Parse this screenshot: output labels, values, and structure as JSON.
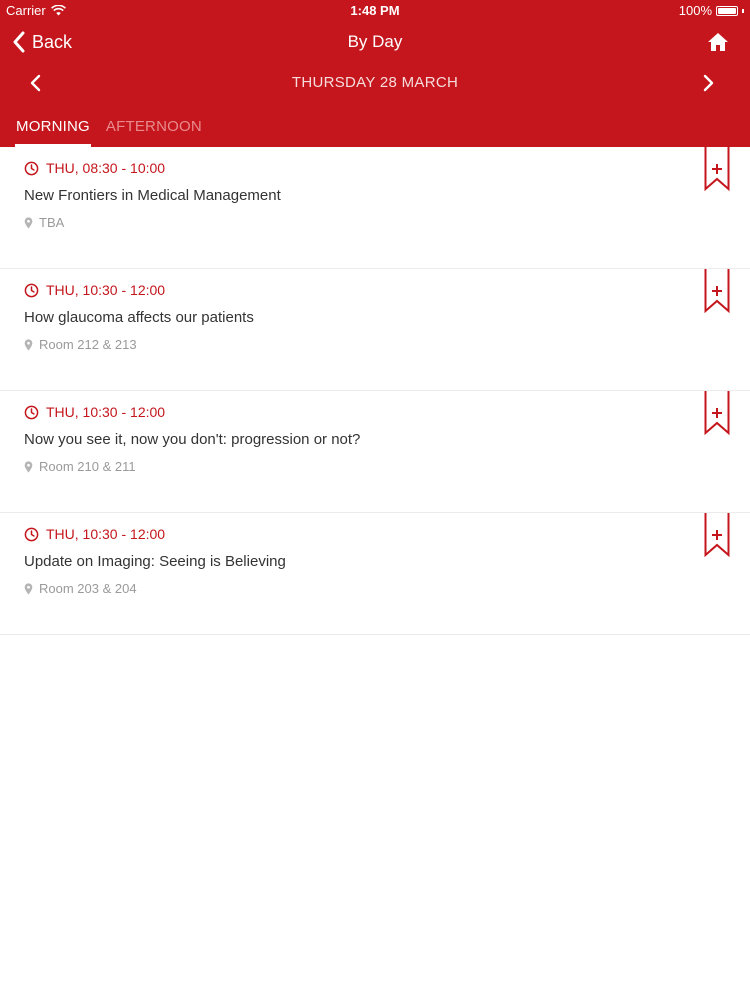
{
  "status_bar": {
    "carrier": "Carrier",
    "time": "1:48 PM",
    "battery": "100%"
  },
  "nav": {
    "back_label": "Back",
    "title": "By Day"
  },
  "date_bar": {
    "label": "THURSDAY 28 MARCH"
  },
  "tabs": [
    {
      "label": "MORNING",
      "active": true
    },
    {
      "label": "AFTERNOON",
      "active": false
    }
  ],
  "sessions": [
    {
      "time": "THU, 08:30 - 10:00",
      "title": "New Frontiers in Medical Management",
      "location": "TBA"
    },
    {
      "time": "THU, 10:30 - 12:00",
      "title": "How glaucoma affects our patients",
      "location": "Room 212 & 213"
    },
    {
      "time": "THU, 10:30 - 12:00",
      "title": "Now you see it, now you don't: progression or not?",
      "location": "Room 210 & 211"
    },
    {
      "time": "THU, 10:30 - 12:00",
      "title": "Update on Imaging: Seeing is Believing",
      "location": "Room 203 & 204"
    }
  ],
  "colors": {
    "brand": "#c4161c",
    "tab_inactive": "#e98b8e",
    "location_text": "#9a9a9a",
    "divider": "#ececec"
  },
  "icons": {
    "back": "chevron-left-icon",
    "home": "home-icon",
    "prev": "chevron-left-icon",
    "next": "chevron-right-icon",
    "time": "clock-icon",
    "location": "map-pin-icon",
    "bookmark": "bookmark-add-icon",
    "wifi": "wifi-icon",
    "battery": "battery-icon"
  }
}
